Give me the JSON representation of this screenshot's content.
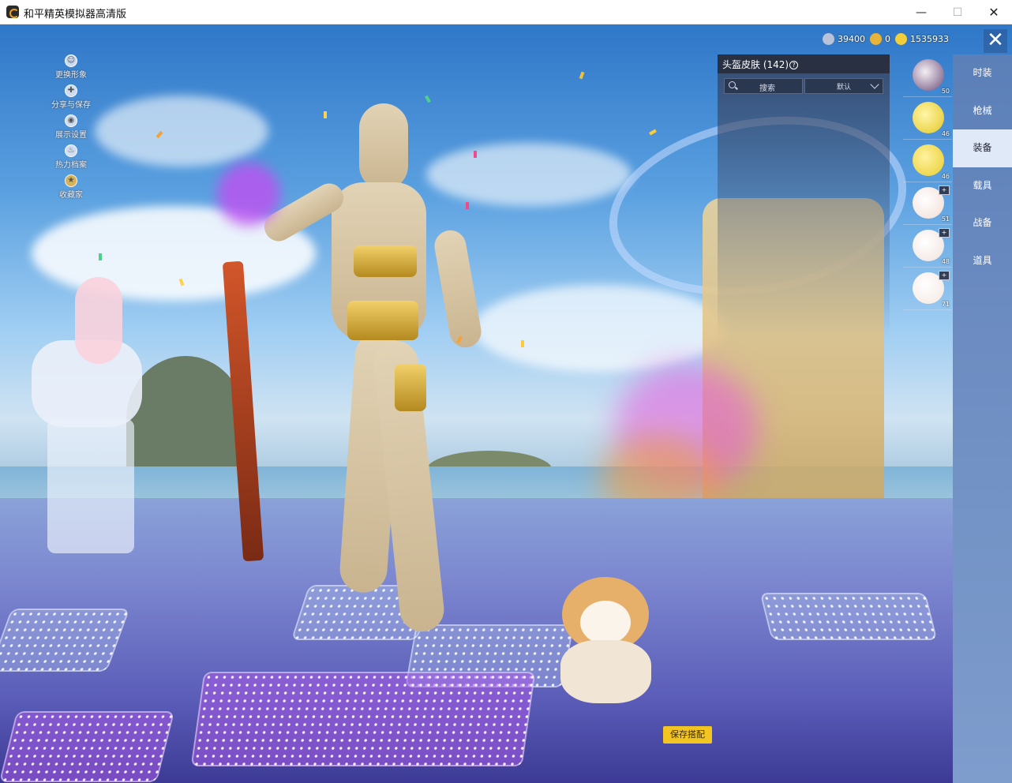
{
  "window": {
    "title": "和平精英模拟器高清版",
    "minimize_icon": "minimize-icon",
    "maximize_icon": "maximize-icon",
    "close_icon": "close-icon"
  },
  "left_menu": [
    {
      "label": "更换形象",
      "icon": "avatar-icon"
    },
    {
      "label": "分享与保存",
      "icon": "share-icon"
    },
    {
      "label": "展示设置",
      "icon": "eye-icon"
    },
    {
      "label": "热力档案",
      "icon": "flame-icon"
    },
    {
      "label": "收藏家",
      "icon": "collector-badge-icon"
    }
  ],
  "currency": [
    {
      "value": "39400",
      "icon": "silver-coin-icon",
      "color": "#b8c2d8"
    },
    {
      "value": "0",
      "icon": "a-coin-icon",
      "color": "#e8b437"
    },
    {
      "value": "1535933",
      "icon": "gold-coin-icon",
      "color": "#f2cf3a"
    }
  ],
  "skin_panel": {
    "title": "头盔皮肤 (142)",
    "search_label": "搜索",
    "sort_label": "默认"
  },
  "items": [
    {
      "count": "50",
      "color": "#6b4a7a",
      "badge": ""
    },
    {
      "count": "46",
      "color": "#e3c624",
      "badge": ""
    },
    {
      "count": "46",
      "color": "#e8cc2a",
      "badge": ""
    },
    {
      "count": "51",
      "color": "#f2dcd4",
      "badge": "+"
    },
    {
      "count": "48",
      "color": "#efe2dc",
      "badge": "+"
    },
    {
      "count": "71",
      "color": "#f4e6e0",
      "badge": "+"
    }
  ],
  "tabs": [
    {
      "label": "时装",
      "active": false
    },
    {
      "label": "枪械",
      "active": false
    },
    {
      "label": "装备",
      "active": true
    },
    {
      "label": "载具",
      "active": false
    },
    {
      "label": "战备",
      "active": false
    },
    {
      "label": "道具",
      "active": false
    }
  ],
  "save_button": "保存搭配",
  "colors": {
    "accent": "#f3c521",
    "tab_bar": "#6d8dc2",
    "tab_active": "#ebf2fc"
  }
}
